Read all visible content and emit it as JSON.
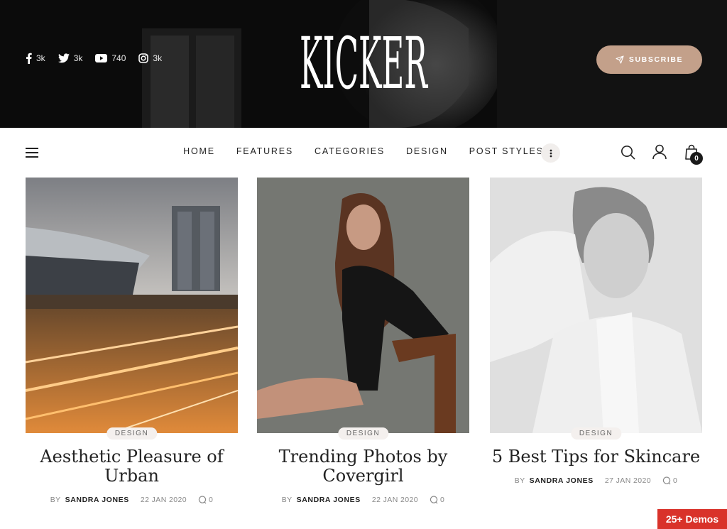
{
  "header": {
    "logo_text": "KICKER",
    "subscribe_label": "SUBSCRIBE",
    "social": [
      {
        "icon": "facebook-icon",
        "count": "3k"
      },
      {
        "icon": "twitter-icon",
        "count": "3k"
      },
      {
        "icon": "youtube-icon",
        "count": "740"
      },
      {
        "icon": "instagram-icon",
        "count": "3k"
      }
    ]
  },
  "nav": {
    "menu": [
      "HOME",
      "FEATURES",
      "CATEGORIES",
      "DESIGN",
      "POST STYLES"
    ],
    "cart_count": "0"
  },
  "posts": [
    {
      "category": "DESIGN",
      "title": "Aesthetic Pleasure of Urban",
      "by": "BY",
      "author": "SANDRA JONES",
      "date": "22 JAN 2020",
      "comments": "0"
    },
    {
      "category": "DESIGN",
      "title": "Trending Photos by Covergirl",
      "by": "BY",
      "author": "SANDRA JONES",
      "date": "22 JAN 2020",
      "comments": "0"
    },
    {
      "category": "DESIGN",
      "title": "5 Best Tips for Skincare",
      "by": "BY",
      "author": "SANDRA JONES",
      "date": "27 JAN 2020",
      "comments": "0"
    }
  ],
  "demos_badge": "25+ Demos",
  "colors": {
    "accent": "#c3a08a",
    "badge_red": "#d9322a",
    "dark": "#0d0d0d"
  }
}
